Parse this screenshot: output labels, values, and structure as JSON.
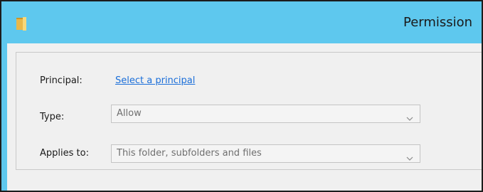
{
  "window": {
    "title": "Permission",
    "icon": "folder-icon"
  },
  "principal": {
    "label": "Principal:",
    "link": "Select a principal"
  },
  "type": {
    "label": "Type:",
    "value": "Allow",
    "icon": "chevron-down-icon"
  },
  "applies_to": {
    "label": "Applies to:",
    "value": "This folder, subfolders and files",
    "icon": "chevron-down-icon"
  },
  "colors": {
    "titlebar": "#5ec8ee",
    "link": "#1a6ed9"
  }
}
